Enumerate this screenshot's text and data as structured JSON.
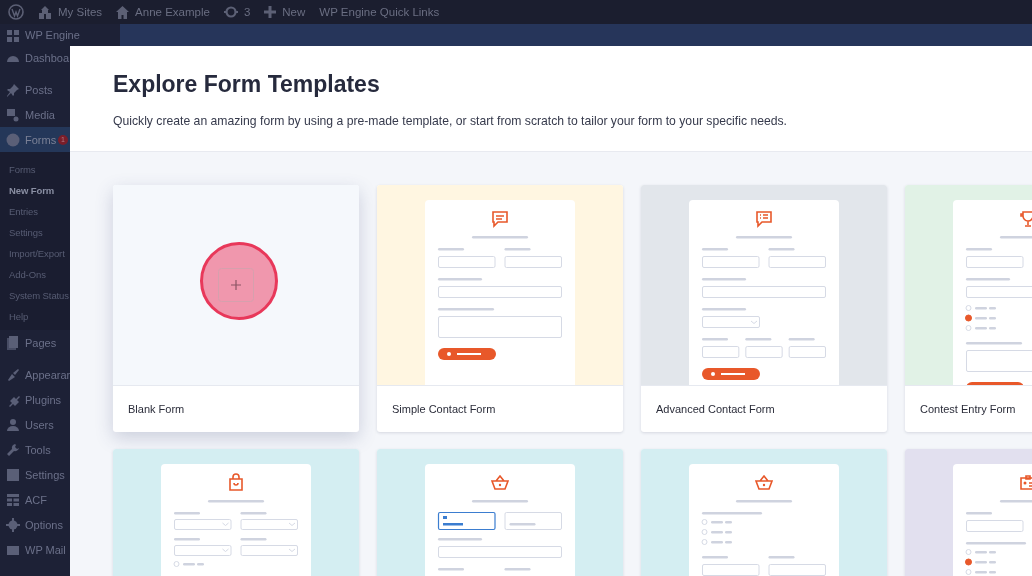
{
  "admin_bar": {
    "items": [
      {
        "kind": "logo"
      },
      {
        "kind": "sites",
        "label": "My Sites"
      },
      {
        "kind": "home",
        "label": "Anne Example"
      },
      {
        "kind": "updates",
        "label": "3"
      },
      {
        "kind": "new",
        "label": "New"
      },
      {
        "kind": "text",
        "label": "WP Engine Quick Links"
      }
    ]
  },
  "sidebar": {
    "items": [
      {
        "kind": "item",
        "label": "WP Engine",
        "selected": false
      },
      {
        "kind": "item",
        "label": "Dashboa",
        "selected": false
      },
      {
        "kind": "separator"
      },
      {
        "kind": "item",
        "label": "Posts",
        "selected": false
      },
      {
        "kind": "item",
        "label": "Media",
        "selected": false
      },
      {
        "kind": "item",
        "label": "Forms",
        "badge": "1",
        "selected": true,
        "children": [
          {
            "label": "Forms",
            "selected": false
          },
          {
            "label": "New Form",
            "selected": true
          },
          {
            "label": "Entries",
            "selected": false
          },
          {
            "label": "Settings",
            "selected": false
          },
          {
            "label": "Import/Export",
            "selected": false
          },
          {
            "label": "Add-Ons",
            "selected": false
          },
          {
            "label": "System Status",
            "selected": false
          },
          {
            "label": "Help",
            "selected": false
          }
        ]
      },
      {
        "kind": "item",
        "label": "Pages",
        "selected": false
      },
      {
        "kind": "separator"
      },
      {
        "kind": "item",
        "label": "Appearar",
        "selected": false
      },
      {
        "kind": "item",
        "label": "Plugins",
        "selected": false
      },
      {
        "kind": "item",
        "label": "Users",
        "selected": false
      },
      {
        "kind": "item",
        "label": "Tools",
        "selected": false
      },
      {
        "kind": "item",
        "label": "Settings",
        "selected": false
      },
      {
        "kind": "item",
        "label": "ACF",
        "selected": false
      },
      {
        "kind": "item",
        "label": "Options",
        "selected": false
      },
      {
        "kind": "item",
        "label": "WP Mail",
        "selected": false
      }
    ]
  },
  "modal": {
    "title": "Explore Form Templates",
    "subtitle": "Quickly create an amazing form by using a pre-made template, or start from scratch to tailor your form to your specific needs.",
    "templates": [
      {
        "kind": "blank",
        "title": "Blank Form",
        "color": "#f5f8fc",
        "highlight": true
      },
      {
        "kind": "template",
        "title": "Simple Contact Form",
        "color": "#fff6e1"
      },
      {
        "kind": "template",
        "title": "Advanced Contact Form",
        "color": "#e2e6eb"
      },
      {
        "kind": "template",
        "title": "Contest Entry Form",
        "color": "#e1f2e6"
      },
      {
        "kind": "template",
        "color": "#d4eef2"
      },
      {
        "kind": "template",
        "color": "#d4eef2"
      },
      {
        "kind": "template",
        "color": "#d4eef2"
      },
      {
        "kind": "template",
        "color": "#e2e0ef"
      }
    ]
  }
}
